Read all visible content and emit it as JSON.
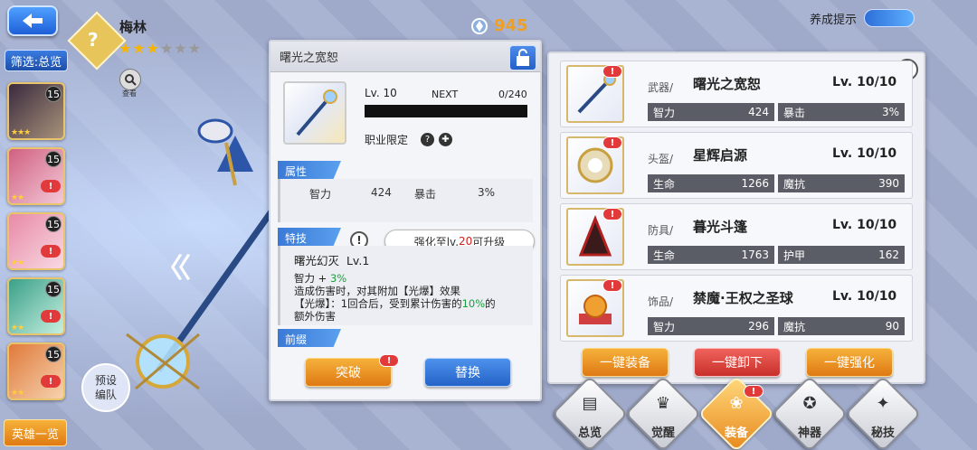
{
  "hero": {
    "name": "梅林",
    "stars_filled": 3,
    "stars_total": 6,
    "view_label": "查看",
    "class_glyph": "?"
  },
  "nav": {
    "filter_label": "筛选:总览",
    "hero_list_label": "英雄一览",
    "preset_line1": "预设",
    "preset_line2": "编队"
  },
  "hero_cards": [
    {
      "level": "15",
      "alert": "!"
    },
    {
      "level": "15",
      "alert": "!"
    },
    {
      "level": "15",
      "alert": "!"
    },
    {
      "level": "15",
      "alert": "!"
    },
    {
      "level": "15",
      "alert": "!"
    }
  ],
  "currency": {
    "value": "945",
    "icon": "crystal-icon"
  },
  "train_hint": {
    "label": "养成提示"
  },
  "detail": {
    "title": "曙光之宽恕",
    "level_label": "Lv. 10",
    "next_label": "NEXT",
    "exp_value": "0/240",
    "job_limit": "职业限定",
    "attr_header": "属性",
    "attrs": [
      {
        "name": "智力",
        "value": "424"
      },
      {
        "name": "暴击",
        "value": "3%"
      }
    ],
    "skill_header": "特技",
    "upgrade_tip_pre": "强化至lv.",
    "upgrade_tip_num": "20",
    "upgrade_tip_post": "可升级",
    "skill_name": "曙光幻灭",
    "skill_level": "Lv.1",
    "skill_line1_pre": "智力 + ",
    "skill_line1_val": "3%",
    "skill_line2": "造成伤害时，对其附加【光爆】效果",
    "skill_line3_pre": "【光爆】：1回合后，受到累计伤害的",
    "skill_line3_val": "10%",
    "skill_line3_post": "的",
    "skill_line4": "额外伤害",
    "prefix_header": "前缀",
    "breakthrough_label": "突破",
    "replace_label": "替换",
    "badge": "!"
  },
  "equipment": [
    {
      "type": "武器/",
      "name": "曙光之宽恕",
      "level": "Lv. 10/10",
      "stats": [
        {
          "name": "智力",
          "value": "424"
        },
        {
          "name": "暴击",
          "value": "3%"
        }
      ]
    },
    {
      "type": "头盔/",
      "name": "星辉启源",
      "level": "Lv. 10/10",
      "stats": [
        {
          "name": "生命",
          "value": "1266"
        },
        {
          "name": "魔抗",
          "value": "390"
        }
      ]
    },
    {
      "type": "防具/",
      "name": "暮光斗篷",
      "level": "Lv. 10/10",
      "stats": [
        {
          "name": "生命",
          "value": "1763"
        },
        {
          "name": "护甲",
          "value": "162"
        }
      ]
    },
    {
      "type": "饰品/",
      "name": "禁魔·王权之圣球",
      "level": "Lv. 10/10",
      "stats": [
        {
          "name": "智力",
          "value": "296"
        },
        {
          "name": "魔抗",
          "value": "90"
        }
      ]
    }
  ],
  "equip_actions": {
    "equip_all": "一键装备",
    "unequip_all": "一键卸下",
    "enhance_all": "一键强化"
  },
  "help": "?",
  "tabs": [
    {
      "label": "总览",
      "glyph": "▤",
      "active": false
    },
    {
      "label": "觉醒",
      "glyph": "♛",
      "active": false
    },
    {
      "label": "装备",
      "glyph": "❀",
      "active": true
    },
    {
      "label": "神器",
      "glyph": "✪",
      "active": false
    },
    {
      "label": "秘技",
      "glyph": "✦",
      "active": false
    }
  ],
  "colors": {
    "accent_blue": "#2d6fd8",
    "accent_orange": "#e88a1e",
    "alert_red": "#e23a3a",
    "gold": "#f0a020"
  }
}
